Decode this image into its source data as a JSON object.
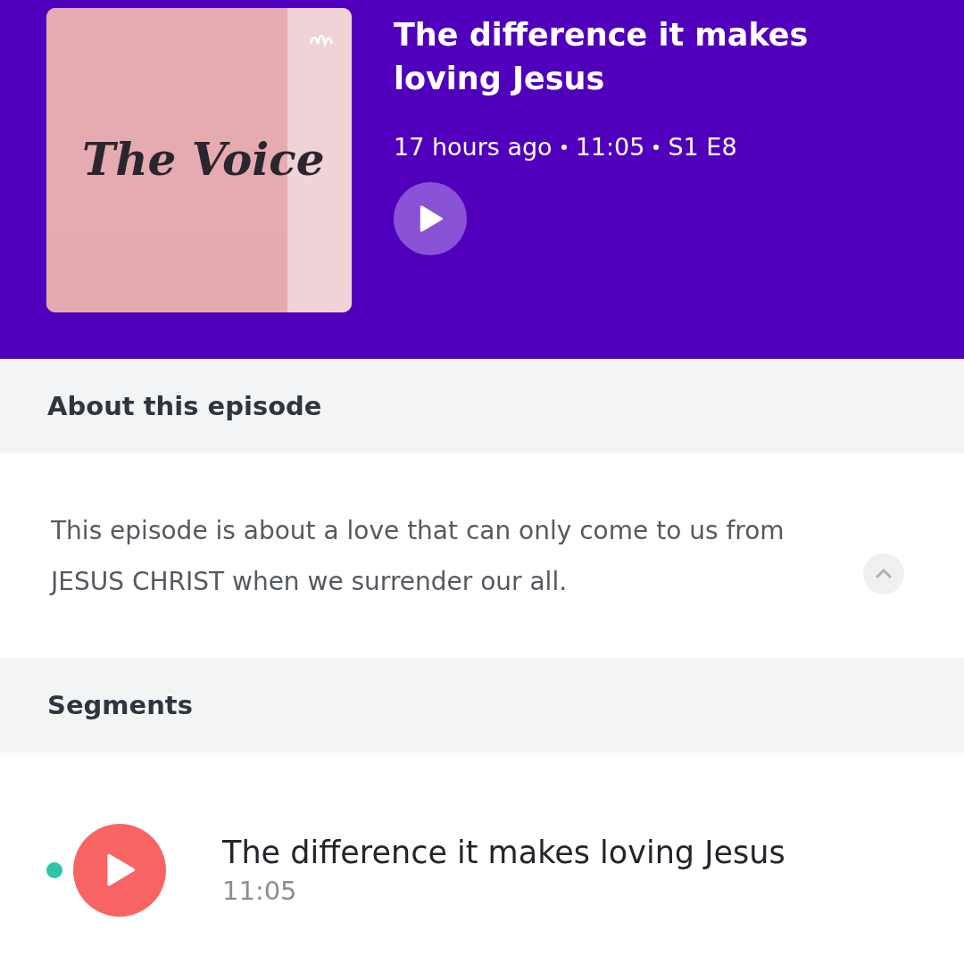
{
  "episode": {
    "cover": {
      "title": "The Voice"
    },
    "title": "The difference it makes loving Jesus",
    "meta": [
      "17 hours ago",
      "11:05",
      "S1 E8"
    ]
  },
  "about": {
    "heading": "About this episode",
    "description": "This episode is about a love that can only come to us from JESUS CHRIST when we surrender our all.",
    "expanded": true
  },
  "segments": {
    "heading": "Segments",
    "items": [
      {
        "title": "The difference it makes loving Jesus",
        "duration": "11:05",
        "color": "#2ec4a8"
      }
    ]
  }
}
